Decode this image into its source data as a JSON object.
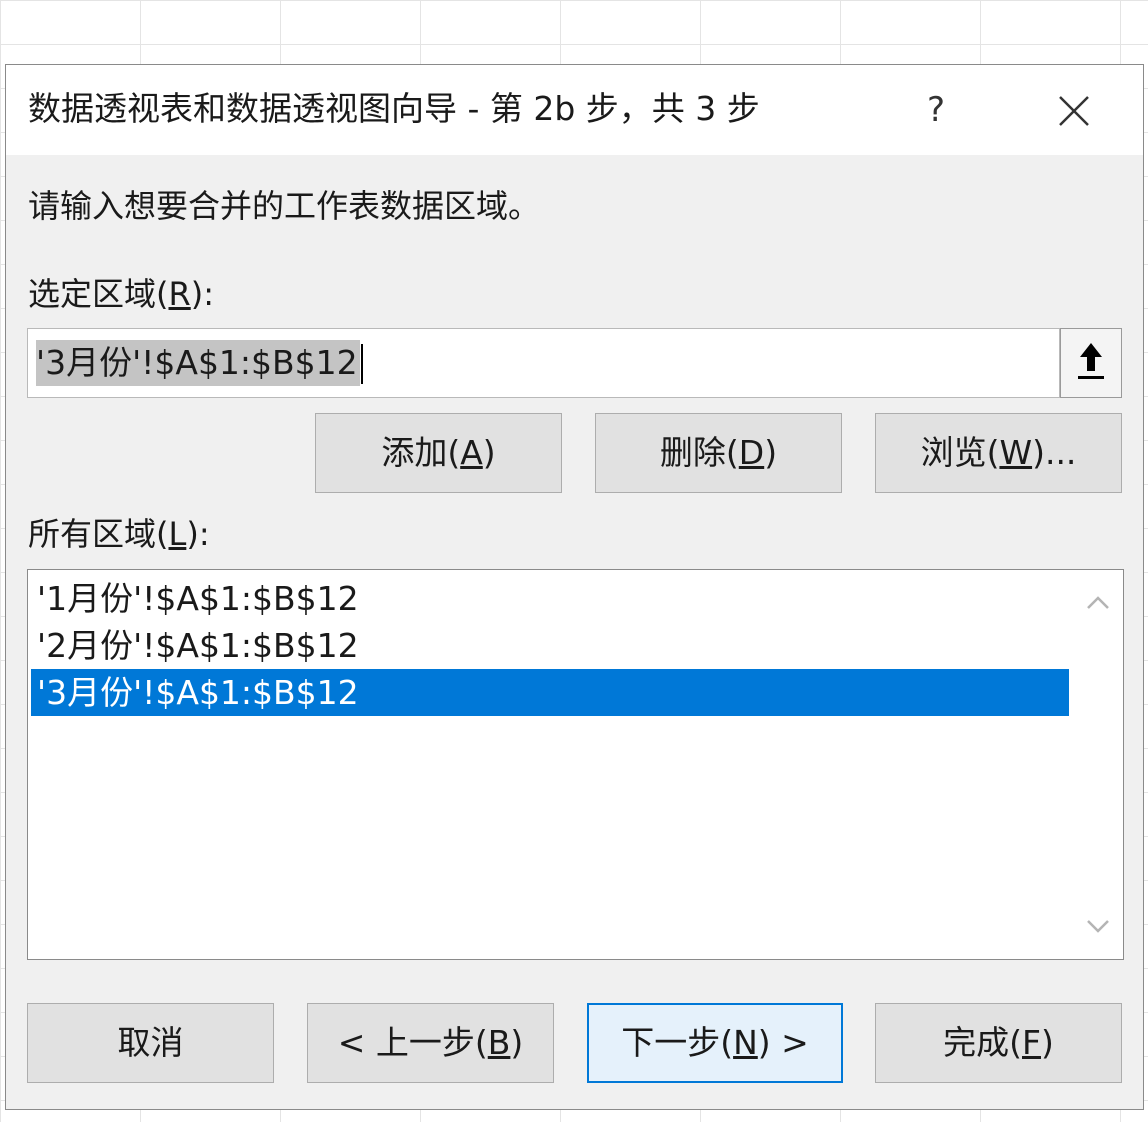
{
  "dialog": {
    "title": "数据透视表和数据透视图向导 - 第 2b 步，共 3 步",
    "help_label": "?",
    "instruction": "请输入想要合并的工作表数据区域。",
    "range_label_main": "选定区域(",
    "range_label_key": "R",
    "range_label_end": "):",
    "range_value": "'3月份'!$A$1:$B$12",
    "buttons": {
      "add_main": "添加(",
      "add_key": "A",
      "add_end": ")",
      "delete_main": "删除(",
      "delete_key": "D",
      "delete_end": ")",
      "browse_main": "浏览(",
      "browse_key": "W",
      "browse_end": ")..."
    },
    "all_ranges_label_main": "所有区域(",
    "all_ranges_label_key": "L",
    "all_ranges_label_end": "):",
    "all_ranges": [
      "'1月份'!$A$1:$B$12",
      "'2月份'!$A$1:$B$12",
      "'3月份'!$A$1:$B$12"
    ],
    "selected_index": 2,
    "footer": {
      "cancel": "取消",
      "back_main": "< 上一步(",
      "back_key": "B",
      "back_end": ")",
      "next_main": "下一步(",
      "next_key": "N",
      "next_end": ") >",
      "finish_main": "完成(",
      "finish_key": "F",
      "finish_end": ")"
    }
  }
}
